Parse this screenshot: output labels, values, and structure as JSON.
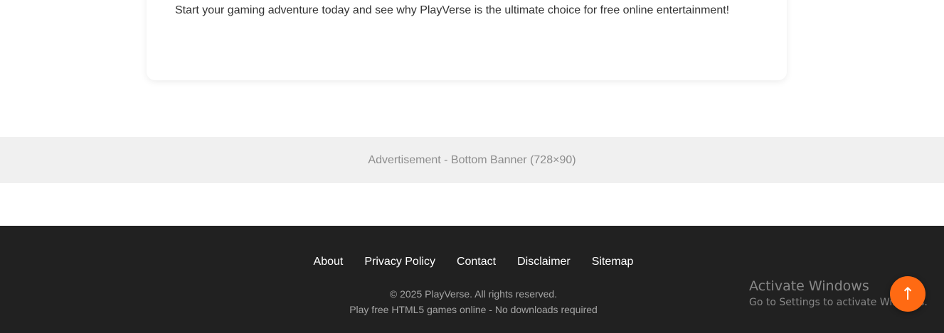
{
  "content": {
    "text": "Start your gaming adventure today and see why PlayVerse is the ultimate choice for free online entertainment!"
  },
  "ad": {
    "label": "Advertisement - Bottom Banner (728×90)"
  },
  "footer": {
    "links": [
      "About",
      "Privacy Policy",
      "Contact",
      "Disclaimer",
      "Sitemap"
    ],
    "copyright": "© 2025 PlayVerse. All rights reserved.",
    "tagline": "Play free HTML5 games online - No downloads required"
  },
  "overlay": {
    "activate_title": "Activate Windows",
    "activate_sub": "Go to Settings to activate Windows."
  },
  "scroll_top": {
    "icon": "↑"
  },
  "colors": {
    "accent": "#ff6a13",
    "footer_bg": "#212121",
    "ad_bg": "#f0f0f0"
  }
}
